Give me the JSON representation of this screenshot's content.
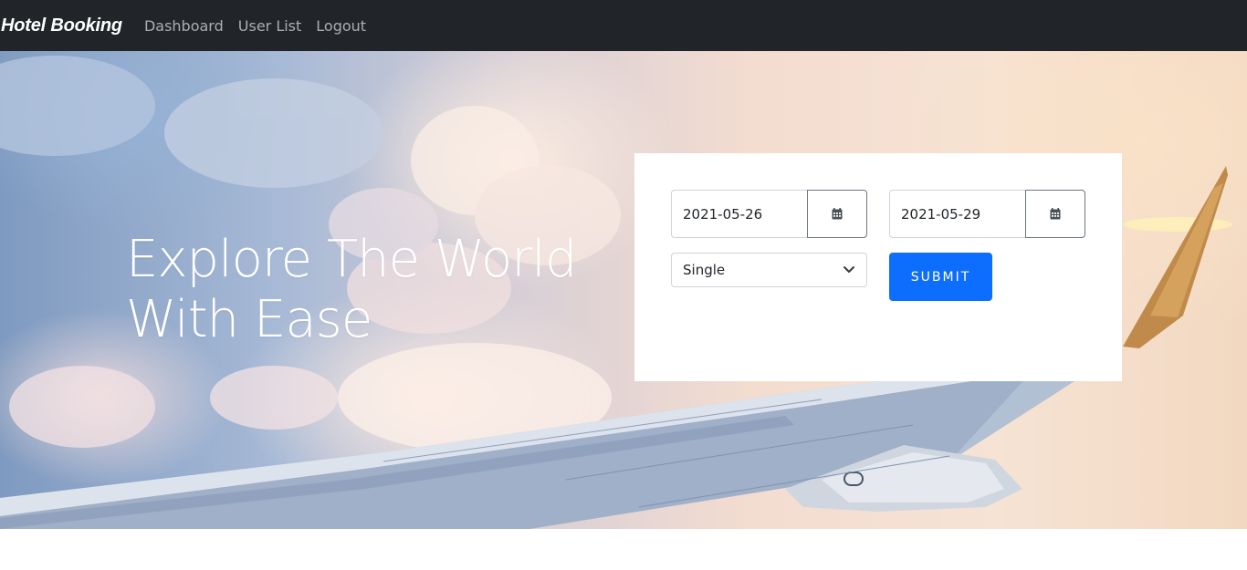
{
  "navbar": {
    "brand": "Hotel Booking",
    "links": [
      "Dashboard",
      "User List",
      "Logout"
    ]
  },
  "hero": {
    "title_line1": "Explore The World",
    "title_line2": "With Ease"
  },
  "booking": {
    "checkin": "2021-05-26",
    "checkout": "2021-05-29",
    "room_type": "Single",
    "submit_label": "SUBMIT",
    "calendar_icon": "calendar-icon",
    "dropdown_icon": "chevron-down-icon"
  },
  "colors": {
    "navbar_bg": "#212529",
    "primary": "#0d6efd",
    "card_bg": "#ffffff"
  }
}
